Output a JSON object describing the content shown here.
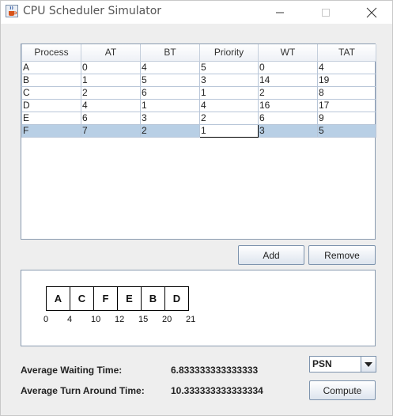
{
  "window": {
    "title": "CPU Scheduler Simulator"
  },
  "table": {
    "columns": [
      "Process",
      "AT",
      "BT",
      "Priority",
      "WT",
      "TAT"
    ],
    "rows": [
      [
        "A",
        "0",
        "4",
        "5",
        "0",
        "4"
      ],
      [
        "B",
        "1",
        "5",
        "3",
        "14",
        "19"
      ],
      [
        "C",
        "2",
        "6",
        "1",
        "2",
        "8"
      ],
      [
        "D",
        "4",
        "1",
        "4",
        "16",
        "17"
      ],
      [
        "E",
        "6",
        "3",
        "2",
        "6",
        "9"
      ],
      [
        "F",
        "7",
        "2",
        "1",
        "3",
        "5"
      ]
    ],
    "selected_row": 5,
    "focused_column": 3
  },
  "buttons": {
    "add": "Add",
    "remove": "Remove",
    "compute": "Compute"
  },
  "gantt": {
    "blocks": [
      "A",
      "C",
      "F",
      "E",
      "B",
      "D"
    ],
    "times": [
      "0",
      "4",
      "10",
      "12",
      "15",
      "20",
      "21"
    ]
  },
  "stats": {
    "awt_label": "Average Waiting Time:",
    "awt_value": "6.833333333333333",
    "atat_label": "Average Turn Around Time:",
    "atat_value": "10.333333333333334"
  },
  "algorithm": {
    "selected": "PSN"
  },
  "colors": {
    "selection": "#b8cfe5",
    "panel_border": "#8a9bb0"
  }
}
